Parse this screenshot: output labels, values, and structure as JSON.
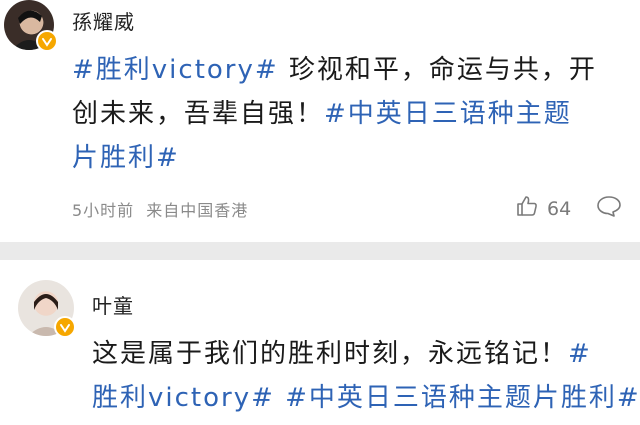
{
  "posts": [
    {
      "username": "孫耀威",
      "body_lines": [
        [
          {
            "t": "#胜利victory#",
            "tag": true
          },
          {
            "t": " 珍视和平，命运与共，开",
            "tag": false
          }
        ],
        [
          {
            "t": "创未来，吾辈自强！",
            "tag": false
          },
          {
            "t": "#中英日三语种主题",
            "tag": true
          }
        ],
        [
          {
            "t": "片胜利#",
            "tag": true
          }
        ]
      ],
      "time": "5小时前",
      "source": "来自中国香港",
      "like_count": "64"
    },
    {
      "username": "叶童",
      "body_lines": [
        [
          {
            "t": "这是属于我们的胜利时刻，永远铭记！",
            "tag": false
          },
          {
            "t": "#",
            "tag": true
          }
        ],
        [
          {
            "t": "胜利victory# #中英日三语种主题片胜利#",
            "tag": true
          }
        ]
      ]
    }
  ],
  "icons": {
    "verified": "verified-badge-icon",
    "like": "thumbs-up-icon",
    "comment": "comment-bubble-icon"
  },
  "colors": {
    "tag": "#2e63b5",
    "verified": "#f6a700",
    "separator": "#eaeaea",
    "meta": "#8a8a8a"
  }
}
